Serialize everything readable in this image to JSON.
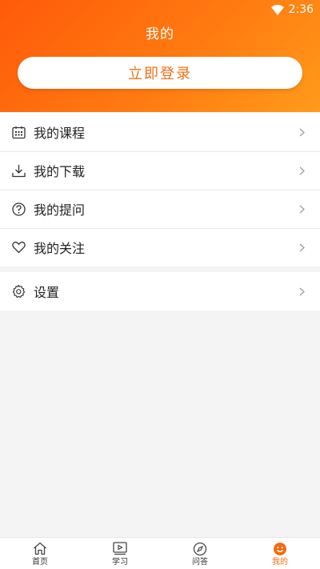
{
  "status_bar": {
    "time": "2:36"
  },
  "header": {
    "title": "我的",
    "login_label": "立即登录"
  },
  "menu": {
    "group1": [
      {
        "label": "我的课程",
        "icon": "calendar-icon"
      },
      {
        "label": "我的下载",
        "icon": "download-icon"
      },
      {
        "label": "我的提问",
        "icon": "question-icon"
      },
      {
        "label": "我的关注",
        "icon": "heart-icon"
      }
    ],
    "group2": [
      {
        "label": "设置",
        "icon": "gear-icon"
      }
    ]
  },
  "tabbar": {
    "tabs": [
      {
        "label": "首页",
        "icon": "home-icon"
      },
      {
        "label": "学习",
        "icon": "video-icon"
      },
      {
        "label": "问答",
        "icon": "compass-icon"
      },
      {
        "label": "我的",
        "icon": "smile-icon",
        "active": true
      }
    ]
  },
  "colors": {
    "accent": "#f07014",
    "header_start": "#ff5a0a",
    "header_end": "#ff9a1a"
  }
}
